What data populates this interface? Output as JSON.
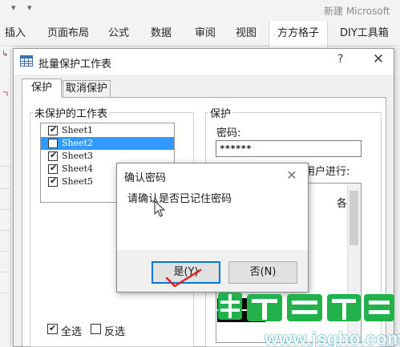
{
  "app": {
    "title": "新建 Microsoft"
  },
  "ribbon": {
    "tabs": [
      {
        "label": "插入"
      },
      {
        "label": "页面布局"
      },
      {
        "label": "公式"
      },
      {
        "label": "数据"
      },
      {
        "label": "审阅"
      },
      {
        "label": "视图"
      },
      {
        "label": "方方格子",
        "active": true
      },
      {
        "label": "DIY工具箱"
      }
    ]
  },
  "dialog": {
    "title": "批量保护工作表",
    "help": "?",
    "close": "✕",
    "tabs": [
      {
        "label": "保护",
        "active": true
      },
      {
        "label": "取消保护"
      }
    ],
    "unprotected_group": {
      "label": "未保护的工作表",
      "sheets": [
        {
          "name": "Sheet1",
          "checked": true,
          "selected": false
        },
        {
          "name": "Sheet2",
          "checked": false,
          "selected": true
        },
        {
          "name": "Sheet3",
          "checked": true,
          "selected": false
        },
        {
          "name": "Sheet4",
          "checked": true,
          "selected": false
        },
        {
          "name": "Sheet5",
          "checked": true,
          "selected": false
        }
      ],
      "select_all": {
        "label": "全选",
        "checked": true
      },
      "invert": {
        "label": "反选",
        "checked": false
      }
    },
    "protect_group": {
      "label": "保护",
      "password_label": "密码:",
      "password_value": "******",
      "permission_label": "用户进行:",
      "permission_suffix": "各"
    }
  },
  "confirm": {
    "title": "确认密码",
    "close": "✕",
    "message": "请确认是否已记住密码",
    "yes_label": "是(Y)",
    "no_label": "否(N)"
  },
  "watermark": {
    "text": "www.jsgho.com"
  },
  "colors": {
    "selection": "#3399ff",
    "default_button_border": "#0078d7",
    "annotation_red": "#e02020",
    "watermark_green": "#22b24c",
    "watermark_blue": "#1f9fc2"
  }
}
